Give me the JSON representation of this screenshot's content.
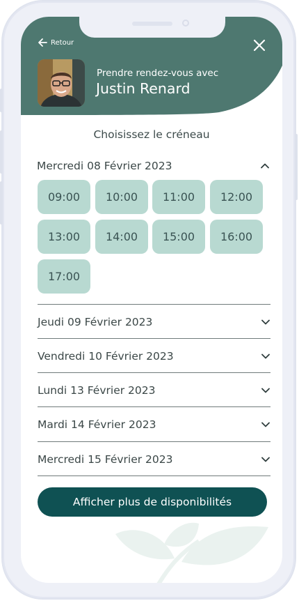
{
  "header": {
    "back_label": "Retour",
    "subtitle": "Prendre rendez-vous avec",
    "name": "Justin Renard",
    "bg_color": "#4e7870"
  },
  "section_title": "Choisissez le créneau",
  "open_day": {
    "label": "Mercredi 08 Février 2023",
    "slots": [
      "09:00",
      "10:00",
      "11:00",
      "12:00",
      "13:00",
      "14:00",
      "15:00",
      "16:00",
      "17:00"
    ]
  },
  "days": [
    {
      "label": "Jeudi 09 Février 2023"
    },
    {
      "label": "Vendredi 10 Février 2023"
    },
    {
      "label": "Lundi 13 Février 2023"
    },
    {
      "label": "Mardi 14 Février 2023"
    },
    {
      "label": "Mercredi 15 Février 2023"
    }
  ],
  "cta_label": "Afficher plus de disponibilités",
  "colors": {
    "accent": "#0f5153",
    "slot_bg": "#b8d9d1",
    "header": "#4e7870"
  }
}
